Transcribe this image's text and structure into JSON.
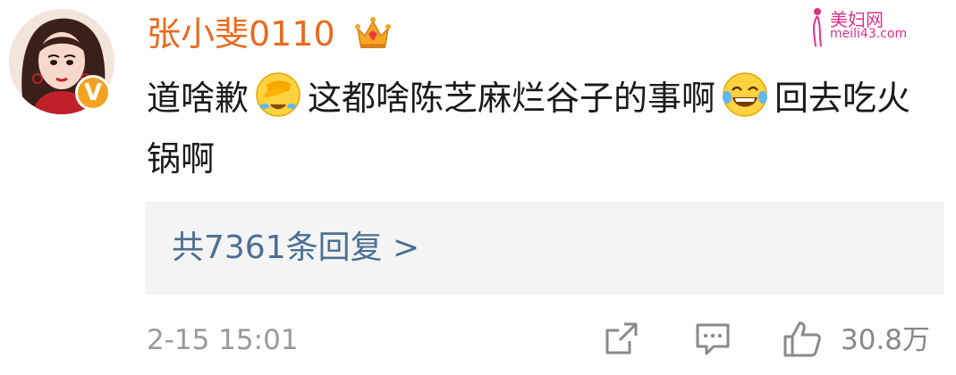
{
  "user": {
    "name": "张小斐0110",
    "verified_badge": "V",
    "crown_icon": "crown-icon"
  },
  "watermark": {
    "title": "美妇网",
    "url": "meili43.com"
  },
  "comment": {
    "part1": "道啥歉",
    "part2": "这都啥陈芝麻烂谷子的事啊",
    "part3": "回去吃火锅啊",
    "emoji1": "face-palm-crying-emoji",
    "emoji2": "laughing-tears-emoji"
  },
  "replies": {
    "label": "共7361条回复 >"
  },
  "footer": {
    "timestamp": "2-15 15:01",
    "likes": "30.8万"
  },
  "colors": {
    "username": "#e86b1e",
    "link": "#4a6f93",
    "muted": "#9a9a9a",
    "badge": "#f2a321"
  }
}
